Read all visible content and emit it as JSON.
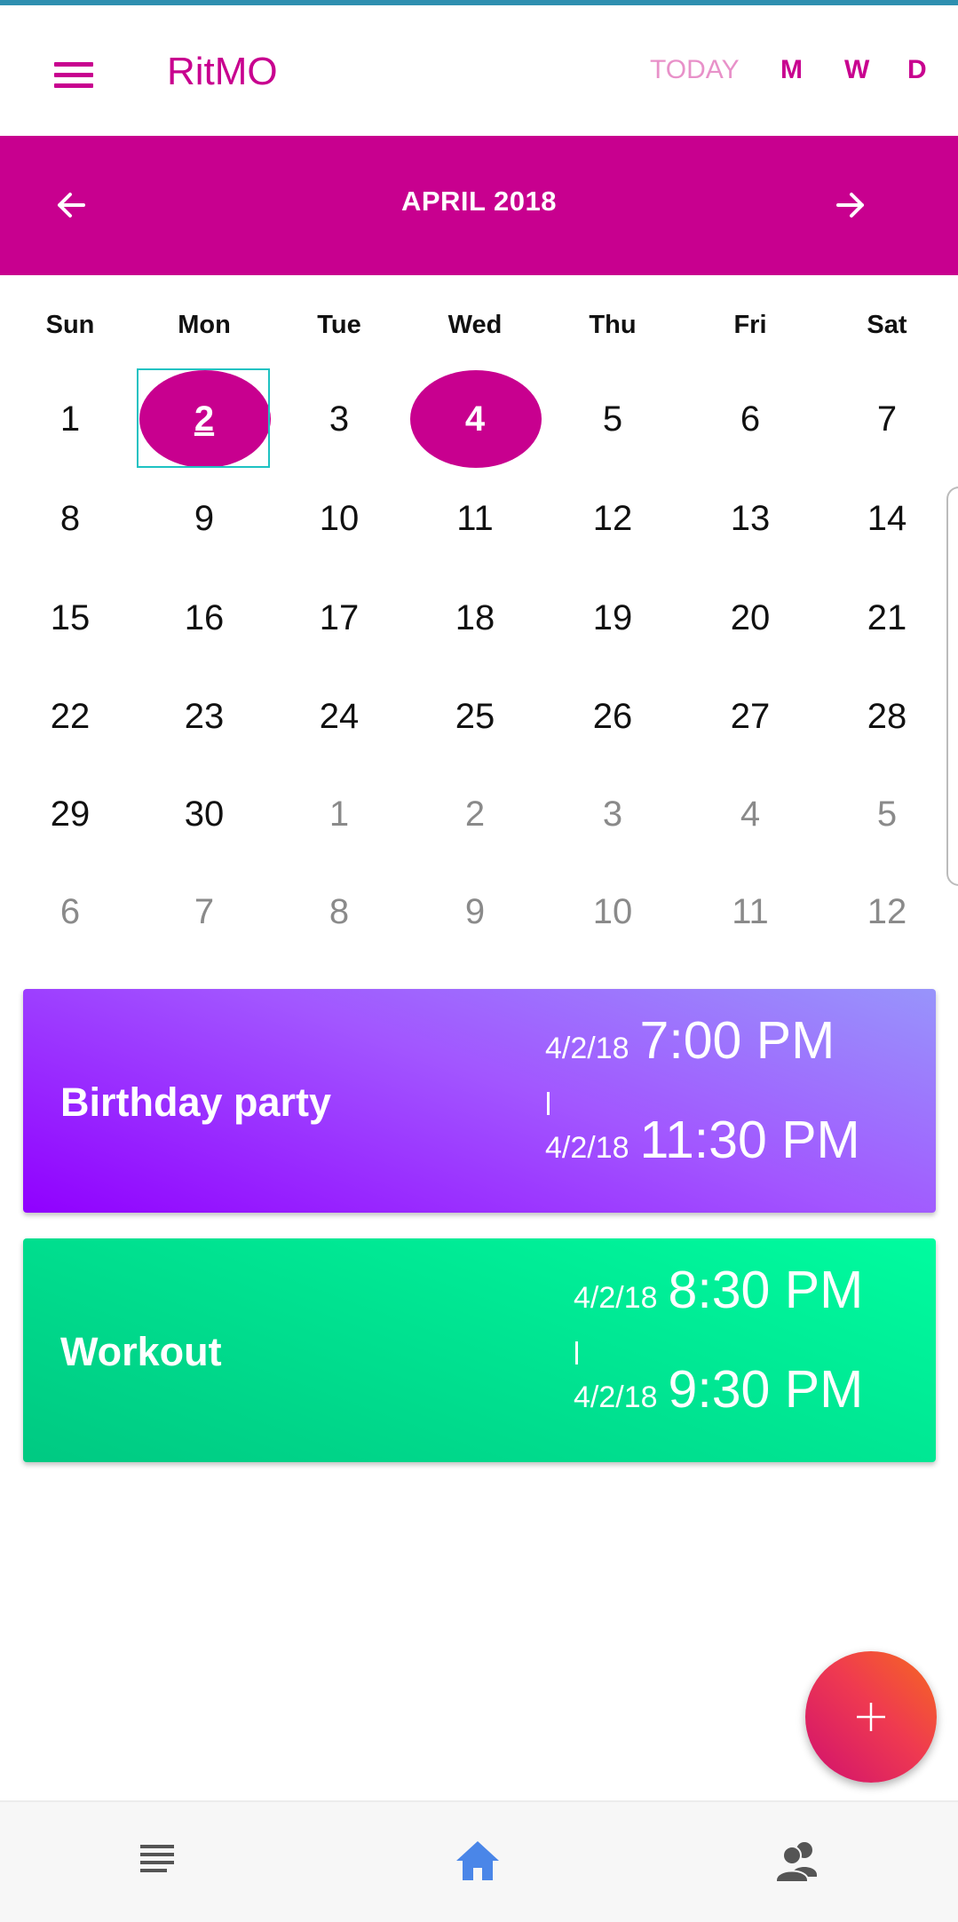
{
  "app": {
    "title": "RitMO",
    "view_modes": [
      "TODAY",
      "M",
      "W",
      "D"
    ]
  },
  "colors": {
    "accent": "#c8008f",
    "today_mode": "#e891c9",
    "focus_outline": "#1ec2c2",
    "event_purple": "#9000ff",
    "event_green": "#00e592",
    "fab": "#ef3a50",
    "home_icon": "#4a86e8"
  },
  "icons": {
    "menu": "menu-icon",
    "prev": "arrow-left-icon",
    "next": "arrow-right-icon",
    "add": "plus-icon",
    "list": "list-icon",
    "home": "home-icon",
    "people": "people-icon"
  },
  "calendar": {
    "month_label": "APRIL 2018",
    "weekdays": [
      "Sun",
      "Mon",
      "Tue",
      "Wed",
      "Thu",
      "Fri",
      "Sat"
    ],
    "weeks": [
      [
        "1",
        "2",
        "3",
        "4",
        "5",
        "6",
        "7"
      ],
      [
        "8",
        "9",
        "10",
        "11",
        "12",
        "13",
        "14"
      ],
      [
        "15",
        "16",
        "17",
        "18",
        "19",
        "20",
        "21"
      ],
      [
        "22",
        "23",
        "24",
        "25",
        "26",
        "27",
        "28"
      ],
      [
        "29",
        "30",
        "1",
        "2",
        "3",
        "4",
        "5"
      ],
      [
        "6",
        "7",
        "8",
        "9",
        "10",
        "11",
        "12"
      ]
    ],
    "selected_day": "2",
    "today_day": "4"
  },
  "events": [
    {
      "title": "Birthday party",
      "start_date": "4/2/18",
      "start_time": "7:00 PM",
      "end_date": "4/2/18",
      "end_time": "11:30 PM"
    },
    {
      "title": "Workout",
      "start_date": "4/2/18",
      "start_time": "8:30 PM",
      "end_date": "4/2/18",
      "end_time": "9:30 PM"
    }
  ]
}
